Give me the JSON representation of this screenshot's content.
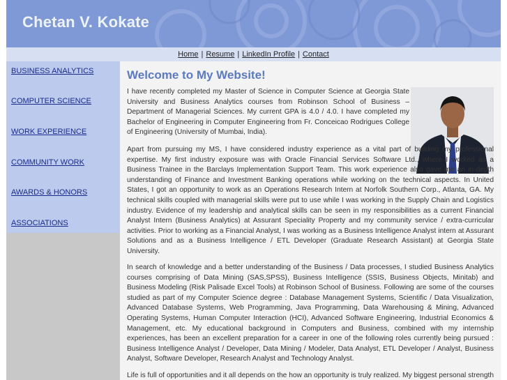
{
  "header": {
    "title": "Chetan V. Kokate"
  },
  "nav": {
    "items": [
      {
        "label": "Home"
      },
      {
        "label": "Resume"
      },
      {
        "label": "LinkedIn Profile"
      },
      {
        "label": "Contact"
      }
    ],
    "separator": "|"
  },
  "sidebar": {
    "items": [
      {
        "label": "BUSINESS ANALYTICS"
      },
      {
        "label": "COMPUTER SCIENCE"
      },
      {
        "label": "WORK EXPERIENCE"
      },
      {
        "label": "COMMUNITY WORK"
      },
      {
        "label": "AWARDS & HONORS"
      },
      {
        "label": "ASSOCIATIONS"
      }
    ]
  },
  "main": {
    "heading": "Welcome to My Website!",
    "paragraphs": [
      "I have recently completed my Master of Science in Computer Science at Georgia State University and Business Analytics courses from Robinson School of Business – Department of Managerial Sciences. My current GPA is 4.0 / 4.0. I have completed my Bachelor of Engineering in Computer Engineering from Fr. Conceicao Rodrigues College of Engineering (University of Mumbai, India).",
      "Apart from pursuing my MS, I have considered industry experience as a vital part of building my professional expertise. My first industry exposure was with Oracle Financial Services Software Ltd., where I worked as a Business Trainee in the Barclays Implementation Support Team. This work experience also gave me an in-depth understanding of Finance and Investment Banking operations while working on the technical aspects. In United States, I got an opportunity to work as an Operations Research Intern at Norfolk Southern Corp., Atlanta, GA. My technical skills coupled with managerial skills were put to use while I was working in the Supply Chain and Logistics industry. Evidence of my leadership and analytical skills can be seen in my responsibilities as a current Financial Analyst Intern (Business Analytics) at Assurant Speciality Property and my community service / extra-curricular activities. Prior to working as a Financial Analyst, I was working as a Business Intelligence Analyst intern at Assurant Solutions and as a Business Intelligence / ETL Developer (Graduate Research Assistant) at Georgia State University.",
      "In search of knowledge and a better understanding of the Business / Data processes, I studied Business Analytics courses comprising of Data Mining (SAS,SPSS), Business Intelligence (SSIS, Business Objects, Minitab) and Business Modeling (Risk Palisade Excel Tools) at Robinson School of Business. Following are some of the courses studied as part of my Computer Science degree : Database Management Systems, Scientific / Data Visualization, Advanced Database Systems, Web Programming, Java Programming, Data Warehousing & Mining, Advanced Operating Systems, Human Computer Interaction (HCI), Advanced Software Engineering, Industrial Economics & Management, etc. My educational background in Computers and Business, combined with my internship experiences, has been an excellent preparation for a career in one of the following roles currently being pursued : Business Intelligence Analyst / Developer, Data Mining / Modeler, Data Analyst, ETL Developer / Analyst, Business Analyst, Software Developer, Research Analyst and Technology Analyst.",
      "Life is full of opportunities and it all depends on the how an opportunity is truly realized. My biggest personal strength is"
    ]
  },
  "colors": {
    "header_bg": "#7f98d6",
    "nav_bg": "#d7dff3",
    "sidebar_bg": "#bccbed",
    "heading": "#5a79c8",
    "link": "#1a2a8a"
  }
}
